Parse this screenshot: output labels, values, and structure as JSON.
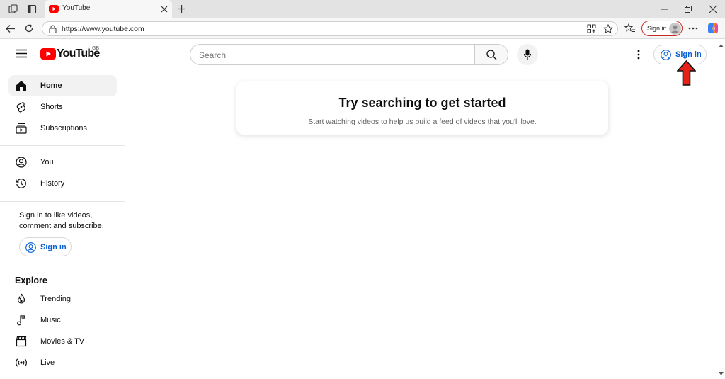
{
  "browser": {
    "tab_title": "YouTube",
    "url": "https://www.youtube.com",
    "signin_label": "Sign in"
  },
  "header": {
    "logo_text": "YouTube",
    "region": "GB",
    "search_placeholder": "Search",
    "signin_label": "Sign in"
  },
  "sidebar": {
    "section1": [
      {
        "label": "Home",
        "icon": "home-icon",
        "active": true
      },
      {
        "label": "Shorts",
        "icon": "shorts-icon"
      },
      {
        "label": "Subscriptions",
        "icon": "subscriptions-icon"
      }
    ],
    "section2": [
      {
        "label": "You",
        "icon": "you-icon"
      },
      {
        "label": "History",
        "icon": "history-icon"
      }
    ],
    "signin_prompt_line1": "Sign in to like videos,",
    "signin_prompt_line2": "comment and subscribe.",
    "signin_label": "Sign in",
    "explore_heading": "Explore",
    "explore": [
      {
        "label": "Trending",
        "icon": "trending-icon"
      },
      {
        "label": "Music",
        "icon": "music-icon"
      },
      {
        "label": "Movies & TV",
        "icon": "movies-icon"
      },
      {
        "label": "Live",
        "icon": "live-icon"
      }
    ]
  },
  "main": {
    "card_title": "Try searching to get started",
    "card_subtitle": "Start watching videos to help us build a feed of videos that you'll love."
  },
  "colors": {
    "brand_red": "#ff0000",
    "link_blue": "#065fd4",
    "annotation_arrow": "#e62117"
  }
}
